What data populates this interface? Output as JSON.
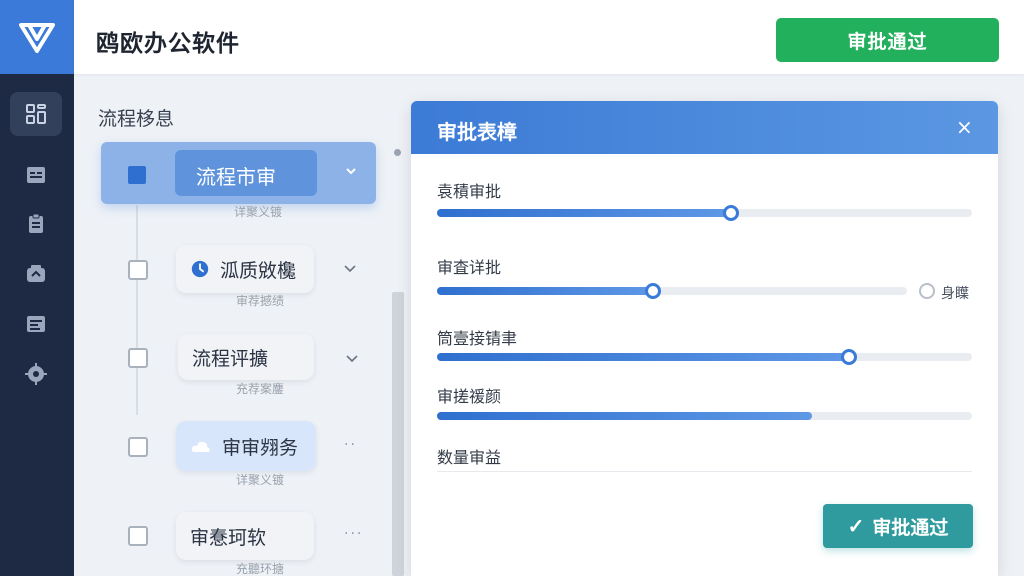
{
  "header": {
    "app_title": "鸥欧办公软件",
    "approve_button": "审批通过"
  },
  "sidebar": {
    "items": [
      {
        "icon": "grid-icon",
        "active": true
      },
      {
        "icon": "list-icon",
        "active": false
      },
      {
        "icon": "clipboard-icon",
        "active": false
      },
      {
        "icon": "share-icon",
        "active": false
      },
      {
        "icon": "document-icon",
        "active": false
      },
      {
        "icon": "gear-icon",
        "active": false
      }
    ]
  },
  "left_panel": {
    "title": "流程栘息",
    "flow_head": {
      "label": "流程市审",
      "sub": "详聚义镀"
    },
    "items": [
      {
        "label": "泒质敓欃",
        "sub": "审荐撼绩",
        "icon": "clock-icon"
      },
      {
        "label": "流程评擴",
        "sub": "充荐案鏖"
      },
      {
        "label": "审审翙务",
        "sub": "详聚义镀",
        "icon": "cloud-icon",
        "highlighted": true
      },
      {
        "label": "审惷珂软",
        "sub": "充聽环搪"
      }
    ]
  },
  "dialog": {
    "title": "审批表樟",
    "close": "×",
    "fields": [
      {
        "label": "袁積审批",
        "value": 0.55
      },
      {
        "label": "审査详批",
        "value": 0.46,
        "radio_label": "身瞸"
      },
      {
        "label": "筒壹接锖聿",
        "value": 0.77
      },
      {
        "label": "审搓禐颜",
        "value": 0.7
      },
      {
        "label": "数量审益"
      }
    ],
    "approve_button": "审批通过",
    "approve_check": "✓"
  },
  "colors": {
    "primary": "#3b7ad9",
    "success": "#22b05c",
    "teal": "#2f9b9e",
    "sidebar": "#1e2a44"
  }
}
